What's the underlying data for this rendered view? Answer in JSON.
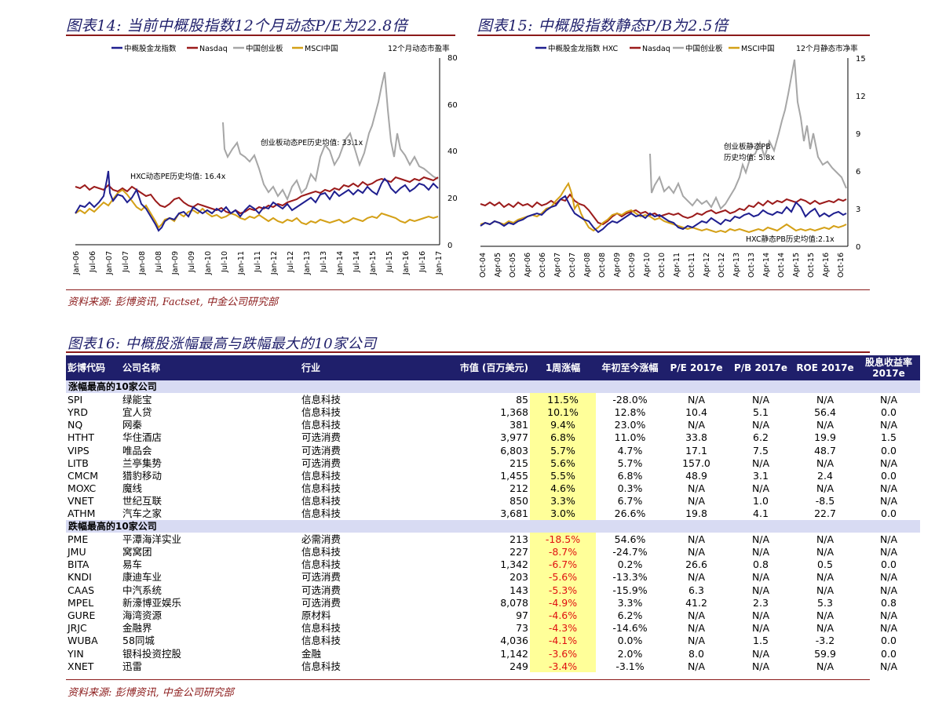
{
  "chart14": {
    "title": "图表14:  当前中概股指数12个月动态P/E为22.8倍",
    "legend": [
      "中概股金龙指数",
      "Nasdaq",
      "中国创业板",
      "MSCI中国"
    ],
    "axis_title": "12个月动态市盈率",
    "annotation_a": "创业板动态PE历史均值: 33.1x",
    "annotation_b": "HXC动态PE历史均值: 16.4x",
    "y_ticks": [
      "80",
      "60",
      "40",
      "20",
      "0"
    ],
    "x_ticks": [
      "Jan-06",
      "Jul-06",
      "Jan-07",
      "Jul-07",
      "Jan-08",
      "Jul-08",
      "Jan-09",
      "Jul-09",
      "Jan-10",
      "Jul-10",
      "Jan-11",
      "Jul-11",
      "Jan-12",
      "Jul-12",
      "Jan-13",
      "Jul-13",
      "Jan-14",
      "Jul-14",
      "Jan-15",
      "Jul-15",
      "Jan-16",
      "Jul-16",
      "Jan-17"
    ]
  },
  "chart15": {
    "title": "图表15:  中概股指数静态P/B为2.5倍",
    "legend": [
      "中概股金龙指数 HXC",
      "Nasdaq",
      "中国创业板",
      "MSCI中国"
    ],
    "axis_title": "12个月静态市净率",
    "annotation_a": "创业板静态PB",
    "annotation_a2": "历史均值: 5.8x",
    "annotation_b": "HXC静态PB历史均值:2.1x",
    "y_ticks": [
      "15",
      "12",
      "9",
      "6",
      "3",
      "0"
    ],
    "x_ticks": [
      "Oct-04",
      "Apr-05",
      "Oct-05",
      "Apr-06",
      "Oct-06",
      "Apr-07",
      "Oct-07",
      "Apr-08",
      "Oct-08",
      "Apr-09",
      "Oct-09",
      "Apr-10",
      "Oct-10",
      "Apr-11",
      "Oct-11",
      "Apr-12",
      "Oct-12",
      "Apr-13",
      "Oct-13",
      "Apr-14",
      "Oct-14",
      "Apr-15",
      "Oct-15",
      "Apr-16",
      "Oct-16"
    ]
  },
  "colors": {
    "hxc": "#1f1f8f",
    "nasdaq": "#9b1b1b",
    "chinext": "#a6a6a6",
    "msci": "#d4a017",
    "title": "#1f1f6b",
    "rule": "#8b1a1a"
  },
  "source_top": "资料来源:  彭博资讯, Factset, 中金公司研究部",
  "table_title": "图表16:  中概股涨幅最高与跌幅最大的10家公司",
  "table": {
    "headers": [
      "彭博代码",
      "公司名称",
      "行业",
      "市值 (百万美元)",
      "1周涨幅",
      "年初至今涨幅",
      "P/E 2017e",
      "P/B 2017e",
      "ROE 2017e",
      "股息收益率 2017e"
    ],
    "group_up": "涨幅最高的10家公司",
    "group_down": "跌幅最高的10家公司",
    "rows_up": [
      [
        "SPI",
        "绿能宝",
        "信息科技",
        "85",
        "11.5%",
        "-28.0%",
        "N/A",
        "N/A",
        "N/A",
        "N/A"
      ],
      [
        "YRD",
        "宜人贷",
        "信息科技",
        "1,368",
        "10.1%",
        "12.8%",
        "10.4",
        "5.1",
        "56.4",
        "0.0"
      ],
      [
        "NQ",
        "网秦",
        "信息科技",
        "381",
        "9.4%",
        "23.0%",
        "N/A",
        "N/A",
        "N/A",
        "N/A"
      ],
      [
        "HTHT",
        "华住酒店",
        "可选消费",
        "3,977",
        "6.8%",
        "11.0%",
        "33.8",
        "6.2",
        "19.9",
        "1.5"
      ],
      [
        "VIPS",
        "唯品会",
        "可选消费",
        "6,803",
        "5.7%",
        "4.7%",
        "17.1",
        "7.5",
        "48.7",
        "0.0"
      ],
      [
        "LITB",
        "兰亭集势",
        "可选消费",
        "215",
        "5.6%",
        "5.7%",
        "157.0",
        "N/A",
        "N/A",
        "N/A"
      ],
      [
        "CMCM",
        "猎豹移动",
        "信息科技",
        "1,455",
        "5.5%",
        "6.8%",
        "48.9",
        "3.1",
        "2.4",
        "0.0"
      ],
      [
        "MOXC",
        "魔线",
        "信息科技",
        "212",
        "4.6%",
        "0.3%",
        "N/A",
        "N/A",
        "N/A",
        "N/A"
      ],
      [
        "VNET",
        "世纪互联",
        "信息科技",
        "850",
        "3.3%",
        "6.7%",
        "N/A",
        "1.0",
        "-8.5",
        "N/A"
      ],
      [
        "ATHM",
        "汽车之家",
        "信息科技",
        "3,681",
        "3.0%",
        "26.6%",
        "19.8",
        "4.1",
        "22.7",
        "0.0"
      ]
    ],
    "rows_down": [
      [
        "PME",
        "平潭海洋实业",
        "必需消费",
        "213",
        "-18.5%",
        "54.6%",
        "N/A",
        "N/A",
        "N/A",
        "N/A"
      ],
      [
        "JMU",
        "窝窝团",
        "信息科技",
        "227",
        "-8.7%",
        "-24.7%",
        "N/A",
        "N/A",
        "N/A",
        "N/A"
      ],
      [
        "BITA",
        "易车",
        "信息科技",
        "1,342",
        "-6.7%",
        "0.2%",
        "26.6",
        "0.8",
        "0.5",
        "0.0"
      ],
      [
        "KNDI",
        "康迪车业",
        "可选消费",
        "203",
        "-5.6%",
        "-13.3%",
        "N/A",
        "N/A",
        "N/A",
        "N/A"
      ],
      [
        "CAAS",
        "中汽系统",
        "可选消费",
        "143",
        "-5.3%",
        "-15.9%",
        "6.3",
        "N/A",
        "N/A",
        "N/A"
      ],
      [
        "MPEL",
        "新濠博亚娱乐",
        "可选消费",
        "8,078",
        "-4.9%",
        "3.3%",
        "41.2",
        "2.3",
        "5.3",
        "0.8"
      ],
      [
        "GURE",
        "海湾资源",
        "原材料",
        "97",
        "-4.6%",
        "6.2%",
        "N/A",
        "N/A",
        "N/A",
        "N/A"
      ],
      [
        "JRJC",
        "金融界",
        "信息科技",
        "73",
        "-4.3%",
        "-14.6%",
        "N/A",
        "N/A",
        "N/A",
        "N/A"
      ],
      [
        "WUBA",
        "58同城",
        "信息科技",
        "4,036",
        "-4.1%",
        "0.0%",
        "N/A",
        "1.5",
        "-3.2",
        "0.0"
      ],
      [
        "YIN",
        "银科投资控股",
        "金融",
        "1,142",
        "-3.6%",
        "2.0%",
        "8.0",
        "N/A",
        "59.9",
        "0.0"
      ],
      [
        "XNET",
        "迅雷",
        "信息科技",
        "249",
        "-3.4%",
        "-3.1%",
        "N/A",
        "N/A",
        "N/A",
        "N/A"
      ]
    ]
  },
  "source_bottom": "资料来源:  彭博资讯, 中金公司研究部"
}
